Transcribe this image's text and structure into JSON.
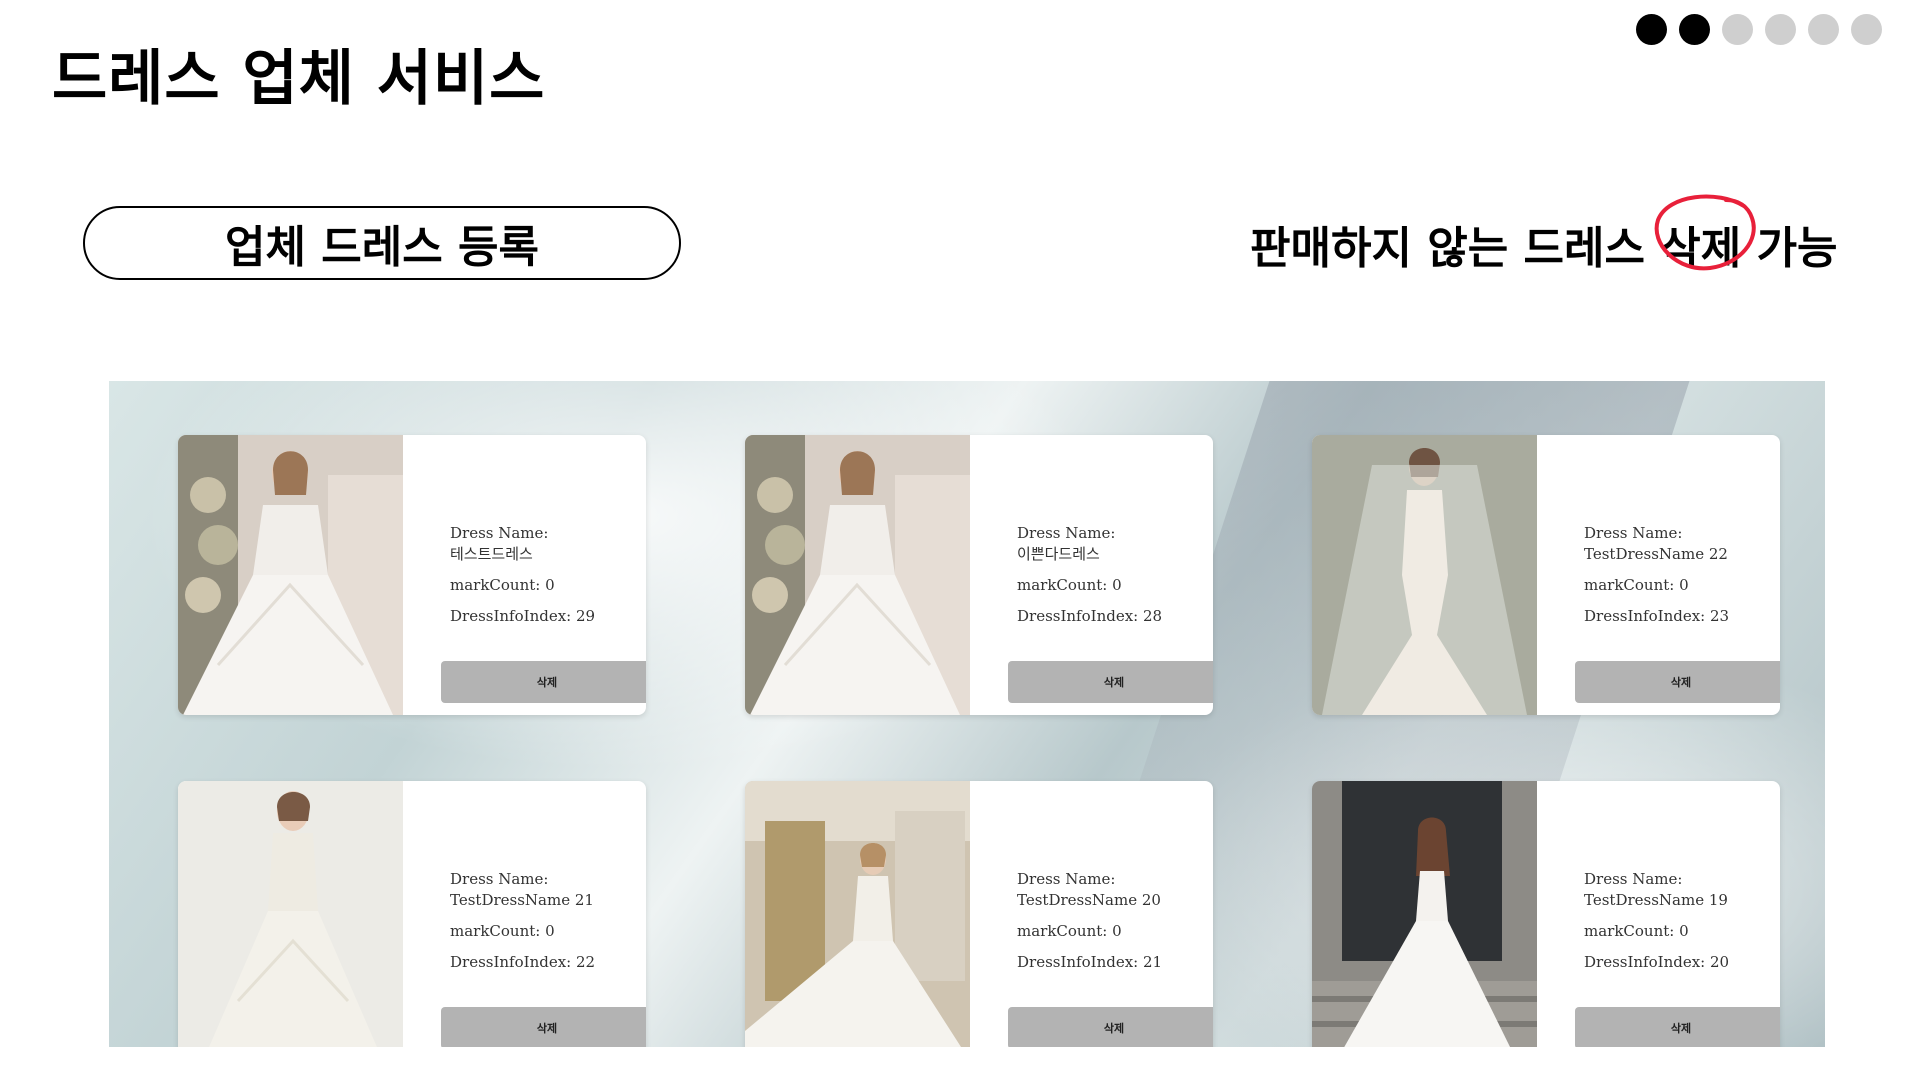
{
  "page": {
    "title": "드레스 업체 서비스",
    "pager_dots": [
      true,
      true,
      false,
      false,
      false,
      false
    ]
  },
  "register_button_label": "업체 드레스 등록",
  "caption": {
    "before": "판매하지 않는 드레스 ",
    "highlight": "삭제",
    "after": " 가능",
    "highlight_color": "#e8203a"
  },
  "cards": [
    {
      "name_label": "Dress Name:",
      "name": "테스트드레스",
      "mark_count": "markCount: 0",
      "index": "DressInfoIndex: 29",
      "delete_label": "삭제",
      "photo": "dress-photo-1"
    },
    {
      "name_label": "Dress Name:",
      "name": "이쁜다드레스",
      "mark_count": "markCount: 0",
      "index": "DressInfoIndex: 28",
      "delete_label": "삭제",
      "photo": "dress-photo-2"
    },
    {
      "name_label": "Dress Name:",
      "name": "TestDressName 22",
      "mark_count": "markCount: 0",
      "index": "DressInfoIndex: 23",
      "delete_label": "삭제",
      "photo": "dress-photo-3"
    },
    {
      "name_label": "Dress Name:",
      "name": "TestDressName 21",
      "mark_count": "markCount: 0",
      "index": "DressInfoIndex: 22",
      "delete_label": "삭제",
      "photo": "dress-photo-4"
    },
    {
      "name_label": "Dress Name:",
      "name": "TestDressName 20",
      "mark_count": "markCount: 0",
      "index": "DressInfoIndex: 21",
      "delete_label": "삭제",
      "photo": "dress-photo-5"
    },
    {
      "name_label": "Dress Name:",
      "name": "TestDressName 19",
      "mark_count": "markCount: 0",
      "index": "DressInfoIndex: 20",
      "delete_label": "삭제",
      "photo": "dress-photo-6"
    }
  ]
}
